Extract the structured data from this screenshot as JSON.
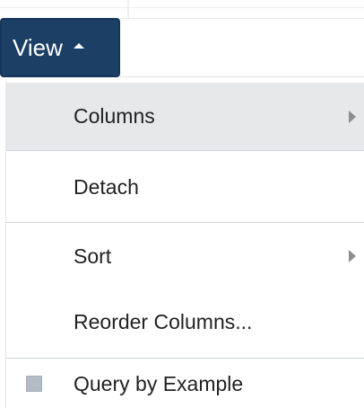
{
  "toolbar": {
    "view_label": "View",
    "view_icon": "caret-up-icon"
  },
  "menu": {
    "items": [
      {
        "label": "Columns",
        "has_submenu": true,
        "highlighted": true
      },
      {
        "label": "Detach",
        "has_submenu": false
      },
      {
        "label": "Sort",
        "has_submenu": true
      },
      {
        "label": "Reorder Columns...",
        "has_submenu": false
      },
      {
        "label": "Query by Example",
        "has_submenu": false,
        "checkbox": true,
        "checked": false
      }
    ]
  },
  "colors": {
    "button_bg": "#1c3f66",
    "highlight_bg": "#e6e8ea",
    "text": "#222222",
    "separator": "#cfd4d9"
  }
}
